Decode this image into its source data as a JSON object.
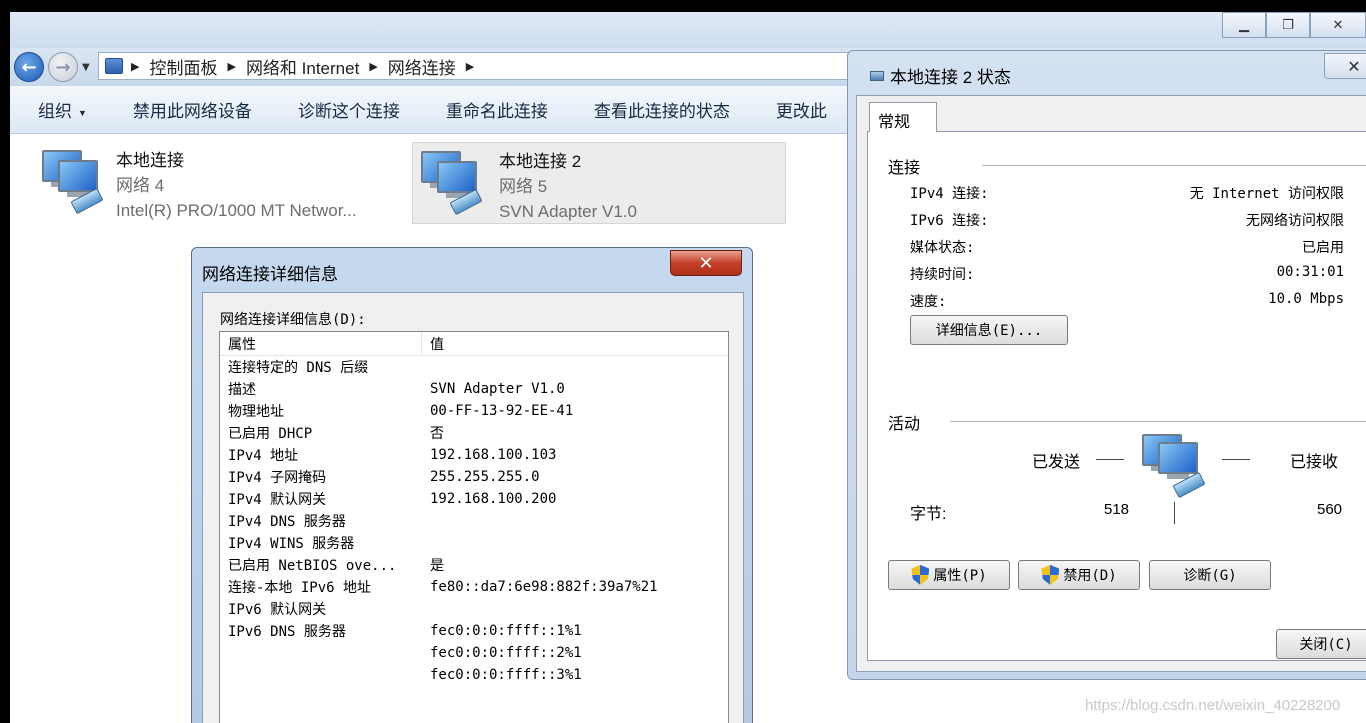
{
  "explorer": {
    "breadcrumbs": [
      "控制面板",
      "网络和 Internet",
      "网络连接"
    ],
    "toolbar": [
      "组织",
      "禁用此网络设备",
      "诊断这个连接",
      "重命名此连接",
      "查看此连接的状态",
      "更改此"
    ],
    "connections": [
      {
        "name": "本地连接",
        "network": "网络 4",
        "adapter": "Intel(R) PRO/1000 MT Networ...",
        "selected": false
      },
      {
        "name": "本地连接 2",
        "network": "网络 5",
        "adapter": "SVN Adapter V1.0",
        "selected": true
      }
    ]
  },
  "details_dialog": {
    "title": "网络连接详细信息",
    "caption": "网络连接详细信息(D):",
    "col_property": "属性",
    "col_value": "值",
    "rows": [
      {
        "property": "连接特定的 DNS 后缀",
        "value": ""
      },
      {
        "property": "描述",
        "value": "SVN Adapter V1.0"
      },
      {
        "property": "物理地址",
        "value": "00-FF-13-92-EE-41"
      },
      {
        "property": "已启用 DHCP",
        "value": "否"
      },
      {
        "property": "IPv4 地址",
        "value": "192.168.100.103"
      },
      {
        "property": "IPv4 子网掩码",
        "value": "255.255.255.0"
      },
      {
        "property": "IPv4 默认网关",
        "value": "192.168.100.200"
      },
      {
        "property": "IPv4 DNS 服务器",
        "value": ""
      },
      {
        "property": "IPv4 WINS 服务器",
        "value": ""
      },
      {
        "property": "已启用 NetBIOS ove...",
        "value": "是"
      },
      {
        "property": "连接-本地 IPv6 地址",
        "value": "fe80::da7:6e98:882f:39a7%21"
      },
      {
        "property": "IPv6 默认网关",
        "value": ""
      },
      {
        "property": "IPv6 DNS 服务器",
        "value": "fec0:0:0:ffff::1%1"
      },
      {
        "property": "",
        "value": "fec0:0:0:ffff::2%1"
      },
      {
        "property": "",
        "value": "fec0:0:0:ffff::3%1"
      }
    ]
  },
  "status_dialog": {
    "title": "本地连接 2 状态",
    "tab": "常规",
    "connection_group": "连接",
    "fields": [
      {
        "label": "IPv4 连接:",
        "value": "无 Internet 访问权限"
      },
      {
        "label": "IPv6 连接:",
        "value": "无网络访问权限"
      },
      {
        "label": "媒体状态:",
        "value": "已启用"
      },
      {
        "label": "持续时间:",
        "value": "00:31:01"
      },
      {
        "label": "速度:",
        "value": "10.0 Mbps"
      }
    ],
    "details_button": "详细信息(E)...",
    "activity_group": "活动",
    "sent_label": "已发送",
    "received_label": "已接收",
    "bytes_label": "字节:",
    "bytes_sent": "518",
    "bytes_received": "560",
    "properties_button": "属性(P)",
    "disable_button": "禁用(D)",
    "diagnose_button": "诊断(G)",
    "close_button": "关闭(C)"
  },
  "watermark": "https://blog.csdn.net/weixin_40228200"
}
